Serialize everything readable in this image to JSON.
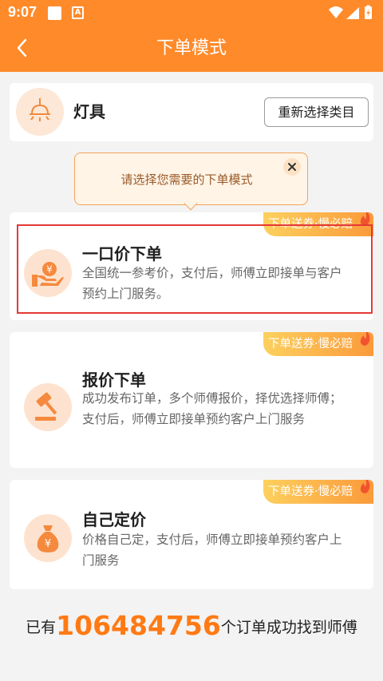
{
  "status": {
    "time": "9:07",
    "a_icon": "A"
  },
  "nav": {
    "title": "下单模式",
    "back_icon": "chevron-left-icon"
  },
  "category": {
    "name": "灯具",
    "reselect": "重新选择类目",
    "icon": "lamp-icon"
  },
  "tip": {
    "text": "请选择您需要的下单模式",
    "close_icon": "close-icon"
  },
  "options": [
    {
      "title": "一口价下单",
      "desc": "全国统一参考价，支付后，师傅立即接单与客户预约上门服务。",
      "badge": "下单送券·慢必赔",
      "icon": "yuan-hand-icon"
    },
    {
      "title": "报价下单",
      "desc": "成功发布订单，多个师傅报价，择优选择师傅；支付后，师傅立即接单预约客户上门服务",
      "badge": "下单送券·慢必赔",
      "icon": "gavel-icon"
    },
    {
      "title": "自己定价",
      "desc": "价格自己定，支付后，师傅立即接单预约客户上门服务",
      "badge": "下单送券·慢必赔",
      "icon": "money-bag-icon"
    }
  ],
  "footer": {
    "prefix": "已有",
    "count": "106484756",
    "suffix": "个订单成功找到师傅"
  },
  "colors": {
    "brand": "#ff8a2a",
    "highlight": "#e53935",
    "badge_start": "#fcd05e",
    "badge_end": "#fb9a3a"
  }
}
